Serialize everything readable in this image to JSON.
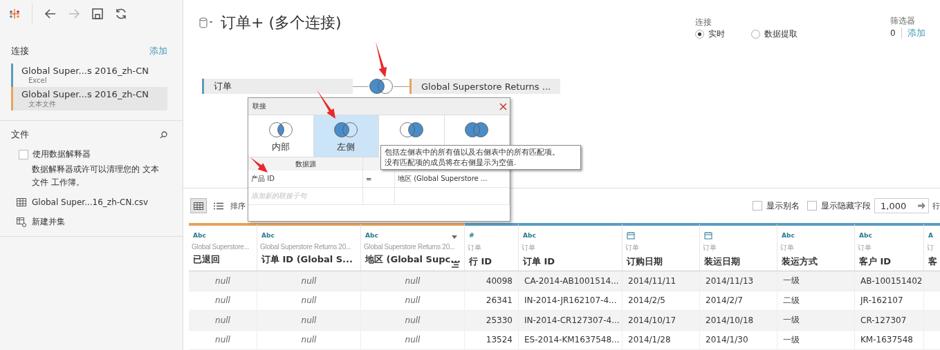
{
  "nav_buttons": [
    {
      "kind": "back",
      "disabled": false
    },
    {
      "kind": "forward",
      "disabled": true
    },
    {
      "kind": "save",
      "disabled": false
    },
    {
      "kind": "refresh",
      "disabled": false
    }
  ],
  "sidebar": {
    "connections_title": "连接",
    "add_link": "添加",
    "connections": [
      {
        "name": "Global Super...s 2016_zh-CN",
        "type": "Excel",
        "color": "#5b9bc0",
        "selected": false
      },
      {
        "name": "Global Super...s 2016_zh-CN",
        "type": "文本文件",
        "color": "#e8a35c",
        "selected": true
      }
    ],
    "files_title": "文件",
    "interpreter": {
      "label": "使用数据解释器",
      "checked": false,
      "note": "数据解释器或许可以清理您的 文本文件 工作簿。"
    },
    "items": [
      {
        "kind": "table",
        "label": "Global Super...16_zh-CN.csv"
      },
      {
        "kind": "union",
        "label": "新建并集"
      }
    ]
  },
  "header": {
    "title": "订单+ (多个连接)",
    "connection": {
      "label": "连接",
      "options": [
        {
          "label": "实时",
          "selected": true
        },
        {
          "label": "数据提取",
          "selected": false
        }
      ]
    },
    "filters": {
      "label": "筛选器",
      "count": "0",
      "add": "添加"
    }
  },
  "canvas": {
    "tables": [
      {
        "name": "订单",
        "color": "#5b9bc0"
      },
      {
        "name": "Global Superstore Returns ...",
        "color": "#e8a35c"
      }
    ],
    "join": {
      "kind": "left"
    }
  },
  "join_dialog": {
    "title": "联接",
    "types": [
      {
        "kind": "inner",
        "label": "内部",
        "selected": false
      },
      {
        "kind": "left",
        "label": "左侧",
        "selected": true
      },
      {
        "kind": "right",
        "selected": false
      },
      {
        "kind": "full",
        "selected": false
      }
    ],
    "left_header": "数据源",
    "clauses": [
      {
        "left": "产品 ID",
        "op": "=",
        "right": "地区 (Global Superstore ..."
      }
    ],
    "placeholder": "添加新的联接子句"
  },
  "tooltip": {
    "lines": [
      "包括左侧表中的所有值以及右侧表中的所有匹配项。",
      "没有匹配项的成员将在右侧显示为空值."
    ]
  },
  "grid_toolbar": {
    "views": [
      {
        "kind": "grid",
        "selected": true
      },
      {
        "kind": "list",
        "selected": false
      }
    ],
    "sort_label": "排序",
    "show_aliases": {
      "label": "显示别名",
      "checked": false
    },
    "show_hidden": {
      "label": "显示隐藏字段",
      "checked": false
    },
    "row_limit": "1,000",
    "rows_label": "行"
  },
  "table": {
    "columns": [
      {
        "kind": "string",
        "type_label": "Abc",
        "source": "Global Superstore...",
        "name": "已退回",
        "color": "#e8a35c",
        "missing": true,
        "hovered": false
      },
      {
        "kind": "string",
        "type_label": "Abc",
        "source": "Global Superstore Returns 20...",
        "name": "订单 ID (Global S...",
        "color": "#e8a35c",
        "missing": true,
        "hovered": false
      },
      {
        "kind": "string",
        "type_label": "Abc",
        "source": "Global Superstore Returns 20...",
        "name": "地区 (Global Supc...",
        "color": "#e8a35c",
        "missing": true,
        "hovered": true
      },
      {
        "kind": "number",
        "type_label": "#",
        "source": "订单",
        "name": "行 ID",
        "color": "#5b9bc0",
        "missing": false,
        "hovered": false
      },
      {
        "kind": "string",
        "type_label": "Abc",
        "source": "订单",
        "name": "订单 ID",
        "color": "#5b9bc0",
        "missing": false,
        "hovered": false
      },
      {
        "kind": "date",
        "source": "订单",
        "name": "订购日期",
        "color": "#5b9bc0",
        "missing": false,
        "hovered": false
      },
      {
        "kind": "date",
        "source": "订单",
        "name": "装运日期",
        "color": "#5b9bc0",
        "missing": false,
        "hovered": false
      },
      {
        "kind": "string",
        "type_label": "Abc",
        "source": "订单",
        "name": "装运方式",
        "color": "#5b9bc0",
        "missing": false,
        "hovered": false
      },
      {
        "kind": "string",
        "type_label": "Abc",
        "source": "订单",
        "name": "客户 ID",
        "color": "#5b9bc0",
        "missing": false,
        "hovered": false
      },
      {
        "kind": "string",
        "type_label": "A",
        "source": "订",
        "name": "客",
        "color": "#5b9bc0",
        "hovered": false
      }
    ],
    "rows": [
      [
        "null",
        "null",
        "null",
        "40098",
        "CA-2014-AB1001514...",
        "2014/11/11",
        "2014/11/13",
        "一级",
        "AB-100151402"
      ],
      [
        "null",
        "null",
        "null",
        "26341",
        "IN-2014-JR162107-4...",
        "2014/2/5",
        "2014/2/7",
        "二级",
        "JR-162107"
      ],
      [
        "null",
        "null",
        "null",
        "25330",
        "IN-2014-CR127307-4...",
        "2014/10/17",
        "2014/10/18",
        "一级",
        "CR-127307"
      ],
      [
        "null",
        "null",
        "null",
        "13524",
        "ES-2014-KM1637548...",
        "2014/1/28",
        "2014/1/30",
        "一级",
        "KM-1637548"
      ]
    ]
  }
}
